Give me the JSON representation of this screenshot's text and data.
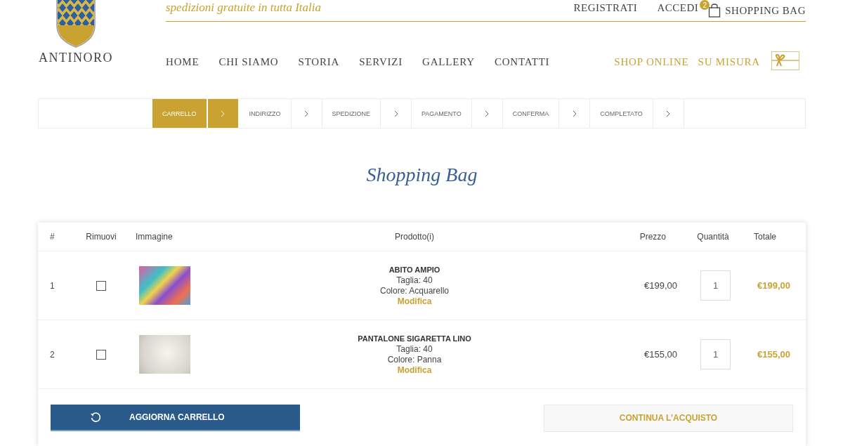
{
  "header": {
    "logo": "ANTINORO",
    "tagline": "spedizioni gratuite in tutta Italia",
    "account_links": [
      "REGISTRATI",
      "ACCEDI"
    ],
    "cart": {
      "badge": "2",
      "label": "SHOPPING BAG"
    },
    "nav": [
      "HOME",
      "CHI SIAMO",
      "STORIA",
      "SERVIZI",
      "GALLERY",
      "CONTATTI"
    ],
    "shop_links": [
      "SHOP ONLINE",
      "SU MISURA"
    ]
  },
  "steps": [
    {
      "label": "CARRELLO",
      "selected": true
    },
    {
      "label": "INDIRIZZO",
      "selected": false
    },
    {
      "label": "SPEDIZIONE",
      "selected": false
    },
    {
      "label": "PAGAMENTO",
      "selected": false
    },
    {
      "label": "CONFERMA",
      "selected": false
    },
    {
      "label": "COMPLETATO",
      "selected": false
    }
  ],
  "title": "Shopping Bag",
  "table": {
    "columns": [
      "#",
      "Rimuovi",
      "Immagine",
      "Prodotto(i)",
      "Prezzo",
      "Quantità",
      "Totale"
    ],
    "rows": [
      {
        "number": "1",
        "checked": false,
        "name": "ABITO AMPIO",
        "size": "Taglia: 40",
        "color_label": "Colore: Acquarello",
        "edit": "Modifica",
        "price": "€199,00",
        "quantity": "1",
        "total": "€199,00"
      },
      {
        "number": "2",
        "checked": false,
        "name": "PANTALONE SIGARETTA LINO",
        "size": "Taglia: 40",
        "color_label": "Colore: Panna",
        "edit": "Modifica",
        "price": "€155,00",
        "quantity": "1",
        "total": "€155,00"
      }
    ]
  },
  "buttons": {
    "update": "AGGIORNA CARRELLO",
    "continue": "CONTINUA L’ACQUISTO"
  }
}
